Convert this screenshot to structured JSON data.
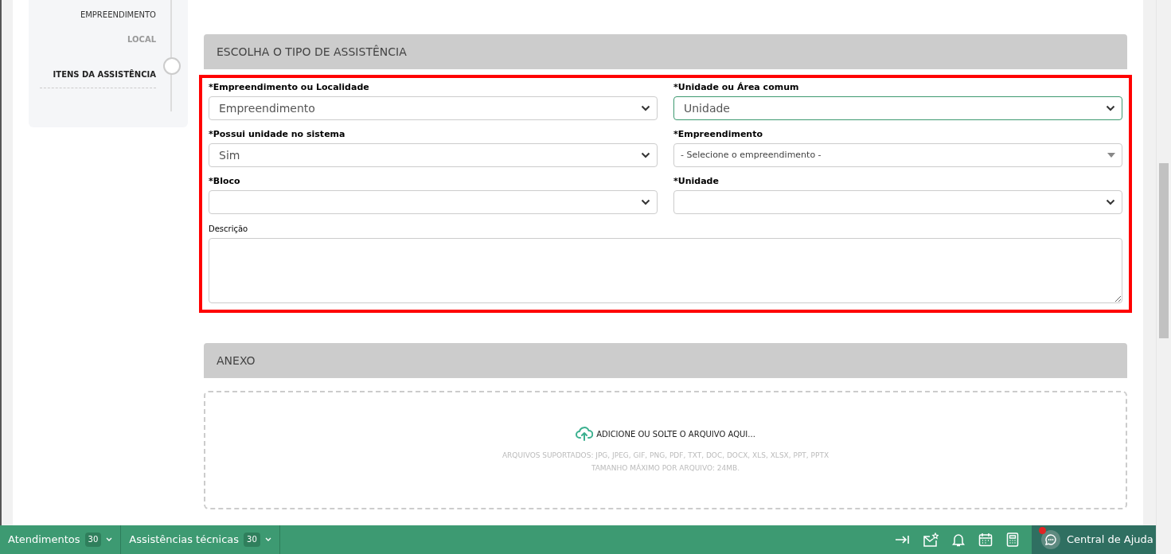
{
  "steps": [
    {
      "label": "EMPREENDIMENTO",
      "kind": "done"
    },
    {
      "label": "LOCAL",
      "kind": "pending"
    },
    {
      "label": "ITENS DA ASSISTÊNCIA",
      "kind": "current"
    }
  ],
  "sections": {
    "type_title": "ESCOLHA O TIPO DE ASSISTÊNCIA",
    "attach_title": "ANEXO"
  },
  "fields": [
    {
      "kind": "select",
      "label": "*Empreendimento ou Localidade",
      "value": "Empreendimento",
      "focused": false
    },
    {
      "kind": "select",
      "label": "*Unidade ou Área comum",
      "value": "Unidade",
      "focused": true
    },
    {
      "kind": "select",
      "label": "*Possui unidade no sistema",
      "value": "Sim",
      "focused": false
    },
    {
      "kind": "combo",
      "label": "*Empreendimento",
      "placeholder": "- Selecione o empreendimento -",
      "focused": false
    },
    {
      "kind": "select",
      "label": "*Bloco",
      "focused": false
    },
    {
      "kind": "select",
      "label": "*Unidade",
      "focused": false
    }
  ],
  "description": {
    "label": "Descrição"
  },
  "upload": {
    "action": "ADICIONE OU SOLTE O ARQUIVO AQUI...",
    "formats": "ARQUIVOS SUPORTADOS: JPG, JPEG, GIF, PNG, PDF, TXT, DOC, DOCX, XLS, XLSX, PPT, PPTX",
    "max_size": "TAMANHO MÁXIMO POR ARQUIVO: 24MB."
  },
  "bottom_tabs": [
    {
      "label": "Atendimentos",
      "count": "30"
    },
    {
      "label": "Assistências técnicas",
      "count": "30"
    }
  ],
  "help": {
    "label": "Central de Ajuda",
    "notification": true
  }
}
